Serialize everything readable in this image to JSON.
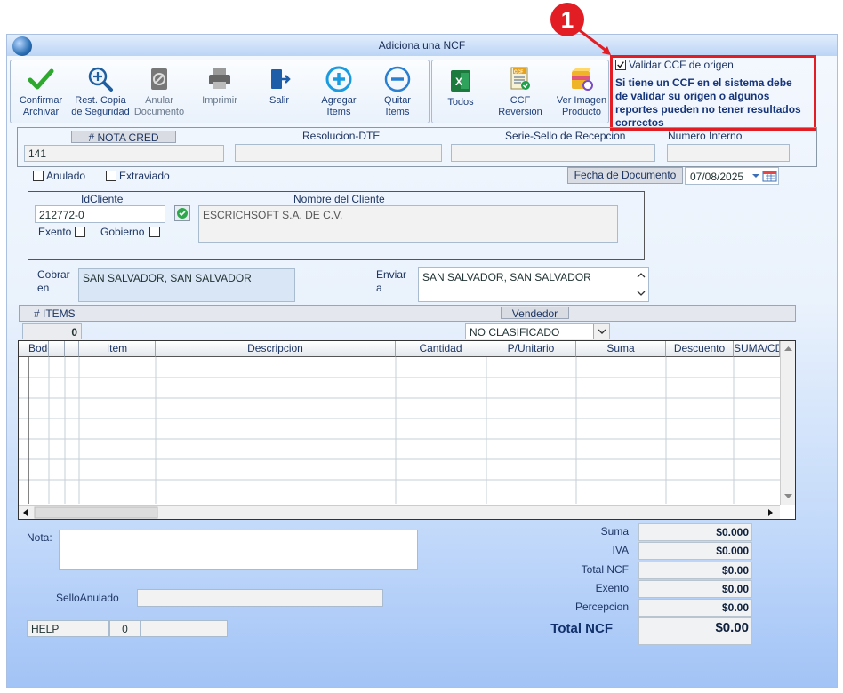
{
  "window": {
    "title": "Adiciona una NCF"
  },
  "toolbar": {
    "confirm": "Confirmar Archivar",
    "restore": "Rest. Copia de Seguridad",
    "void": "Anular Documento",
    "print": "Imprimir",
    "exit": "Salir",
    "add_items": "Agregar Items",
    "remove_items": "Quitar Items",
    "all": "Todos",
    "ccf_reversion": "CCF Reversion",
    "view_image": "Ver Imagen Producto",
    "ccf_icon_text": "CCF"
  },
  "validate": {
    "checkbox_label": "Validar CCF de origen",
    "checked": true,
    "note": "Si tiene un CCF en el sistema debe de validar su origen o algunos reportes pueden no tener resultados correctos"
  },
  "annotation": {
    "number": "1"
  },
  "header": {
    "nota_cred_label": "# NOTA CRED",
    "nota_cred_value": "141",
    "resolucion_label": "Resolucion-DTE",
    "resolucion_value": "",
    "serie_label": "Serie-Sello de Recepcion",
    "serie_value": "",
    "numero_interno_label": "Numero Interno",
    "numero_interno_value": ""
  },
  "flags": {
    "anulado": "Anulado",
    "extraviado": "Extraviado"
  },
  "fecha": {
    "label": "Fecha de  Documento",
    "value": "07/08/2025"
  },
  "cliente": {
    "id_label": "IdCliente",
    "id_value": "212772-0",
    "nombre_label": "Nombre del Cliente",
    "nombre_value": "ESCRICHSOFT S.A. DE C.V.",
    "exento": "Exento",
    "gobierno": "Gobierno"
  },
  "cobrar": {
    "label": "Cobrar en",
    "value": "SAN SALVADOR, SAN SALVADOR"
  },
  "enviar": {
    "label": "Enviar a",
    "value": "SAN SALVADOR, SAN SALVADOR"
  },
  "items": {
    "label": "# ITEMS",
    "count": "0"
  },
  "vendedor": {
    "label": "Vendedor",
    "value": "NO CLASIFICADO"
  },
  "grid": {
    "columns": [
      "",
      "Bodega",
      "",
      "",
      "Item",
      "Descripcion",
      "Cantidad",
      "P/Unitario",
      "Suma",
      "Descuento",
      "SUMA/CD"
    ]
  },
  "nota": {
    "label": "Nota:",
    "value": ""
  },
  "sello": {
    "label": "SelloAnulado",
    "value": ""
  },
  "help": {
    "label": "HELP",
    "value": "0"
  },
  "totals": {
    "suma_label": "Suma",
    "suma": "$0.000",
    "iva_label": "IVA",
    "iva": "$0.000",
    "total_ncf_label": "Total NCF",
    "total_ncf": "$0.00",
    "exento_label": "Exento",
    "exento": "$0.00",
    "percepcion_label": "Percepcion",
    "percepcion": "$0.00",
    "grand_label": "Total NCF",
    "grand": "$0.00"
  }
}
